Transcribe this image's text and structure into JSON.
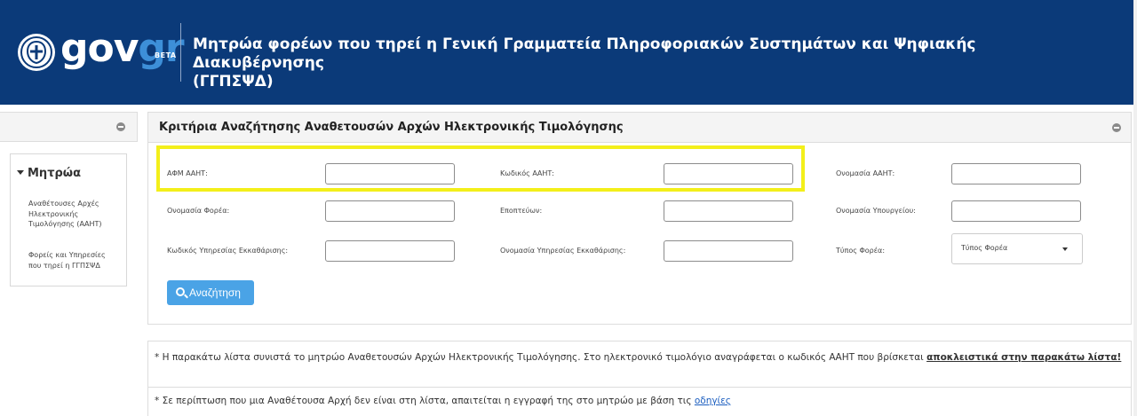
{
  "header": {
    "brand_gov": "gov",
    "brand_gr": "gr",
    "beta": "BETA",
    "title_line1": "Μητρώα φορέων που τηρεί η Γενική Γραμματεία Πληροφοριακών Συστημάτων και Ψηφιακής Διακυβέρνησης",
    "title_line2": "(ΓΓΠΣΨΔ)",
    "bg_color": "#0b3a79"
  },
  "sidebar": {
    "section_title": "Μητρώα",
    "items": [
      {
        "label": "Αναθέτουσες Αρχές Ηλεκτρονικής Τιμολόγησης (ΑΑΗΤ)"
      },
      {
        "label": "Φορείς και Υπηρεσίες που τηρεί η ΓΓΠΣΨΔ"
      }
    ]
  },
  "panel": {
    "title": "Κριτήρια Αναζήτησης Αναθετουσών Αρχών Ηλεκτρονικής Τιμολόγησης",
    "fields": {
      "afm": {
        "label": "ΑΦΜ ΑΑΗΤ:",
        "value": ""
      },
      "code": {
        "label": "Κωδικός ΑΑΗΤ:",
        "value": ""
      },
      "name": {
        "label": "Ονομασία ΑΑΗΤ:",
        "value": ""
      },
      "entity_name": {
        "label": "Ονομασία Φορέα:",
        "value": ""
      },
      "supervisor": {
        "label": "Εποπτεύων:",
        "value": ""
      },
      "ministry": {
        "label": "Ονομασία Υπουργείου:",
        "value": ""
      },
      "clearing_code": {
        "label": "Κωδικός Υπηρεσίας Εκκαθάρισης:",
        "value": ""
      },
      "clearing_name": {
        "label": "Ονομασία Υπηρεσίας Εκκαθάρισης:",
        "value": ""
      },
      "entity_type": {
        "label": "Τύπος Φορέα:",
        "selected": "Τύπος Φορέα"
      }
    },
    "search_button": "Αναζήτηση",
    "highlight_color": "#f3ef1a"
  },
  "notes": {
    "note1_text": "* Η παρακάτω λίστα συνιστά το μητρώο Αναθετουσών Αρχών Ηλεκτρονικής Τιμολόγησης. Στο ηλεκτρονικό τιμολόγιο αναγράφεται ο κωδικός ΑΑΗΤ που βρίσκεται ",
    "note1_bold": "αποκλειστικά στην παρακάτω λίστα!",
    "note2_text": "* Σε περίπτωση που μια Αναθέτουσα Αρχή δεν είναι στη λίστα, απαιτείται η εγγραφή της στο μητρώο με βάση τις ",
    "note2_link": "οδηγίες"
  }
}
